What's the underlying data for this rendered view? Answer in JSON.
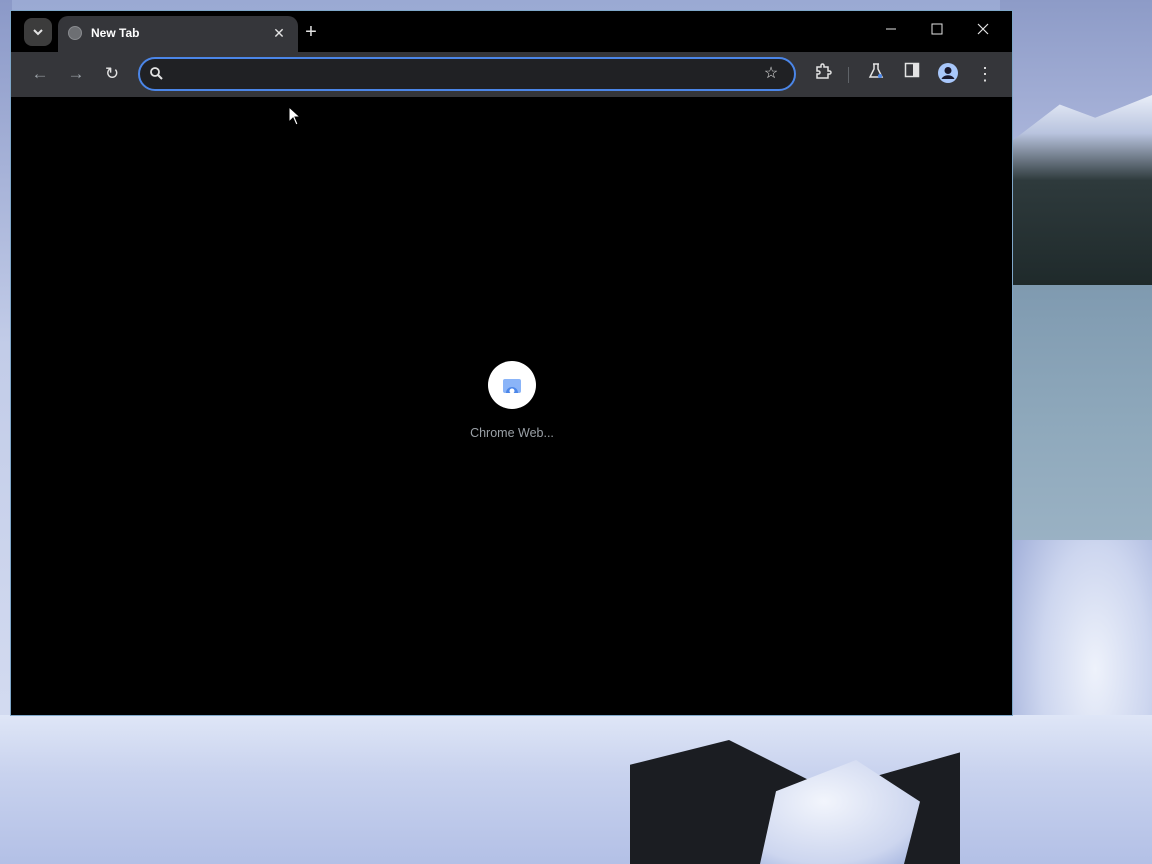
{
  "browser": {
    "tab": {
      "title": "New Tab"
    },
    "omnibox": {
      "value": "",
      "placeholder": ""
    },
    "shortcut": {
      "label": "Chrome Web..."
    }
  },
  "icons": {
    "tab_search": "chevron-down-icon",
    "favicon": "globe-icon",
    "tab_close": "close-icon",
    "new_tab": "plus-icon",
    "minimize": "minimize-icon",
    "maximize": "maximize-icon",
    "window_close": "close-icon",
    "back": "arrow-left-icon",
    "forward": "arrow-right-icon",
    "reload": "reload-icon",
    "search": "search-icon",
    "bookmark": "star-icon",
    "extensions": "puzzle-icon",
    "labs": "flask-icon",
    "side_panel": "side-panel-icon",
    "profile": "avatar-icon",
    "menu": "kebab-menu-icon"
  },
  "colors": {
    "window_bg": "#000000",
    "toolbar_bg": "#35363a",
    "omnibox_focus": "#4b86e8",
    "text_primary": "#ffffff",
    "text_secondary": "#9aa0a6"
  }
}
